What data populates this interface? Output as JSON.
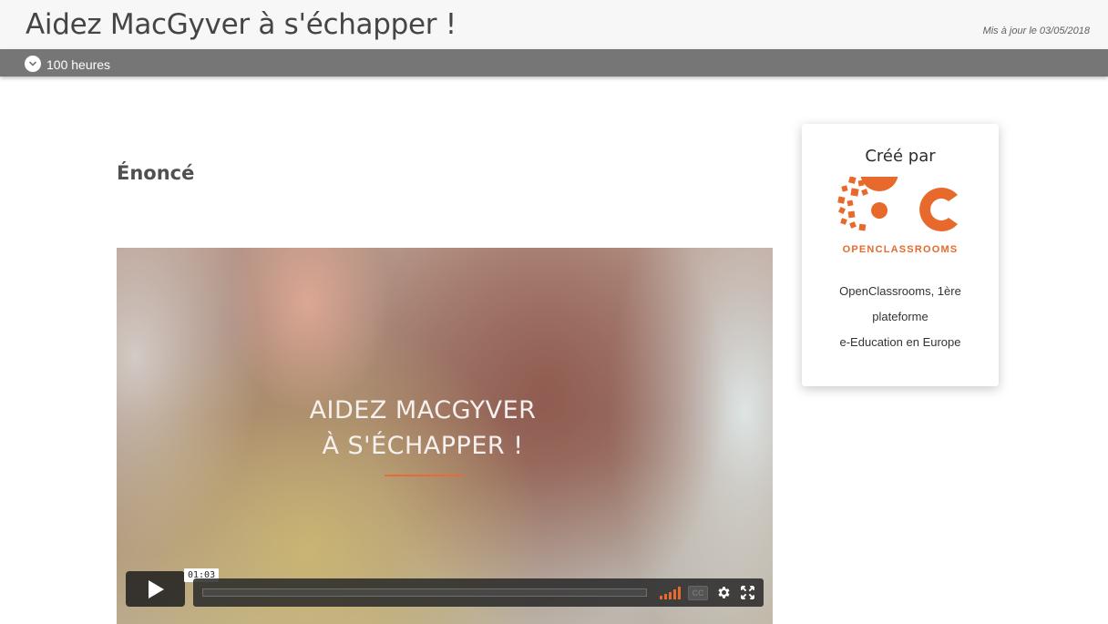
{
  "header": {
    "title": "Aidez MacGyver à s'échapper !",
    "updated": "Mis à jour le 03/05/2018"
  },
  "duration": {
    "icon": "chevron-down-icon",
    "label": "100 heures"
  },
  "main": {
    "section_title": "Énoncé"
  },
  "video": {
    "title_line1": "AIDEZ MACGYVER",
    "title_line2": "À S'ÉCHAPPER !",
    "duration_badge": "01:03",
    "progress": 0,
    "cc_label": "CC",
    "accent_color": "#e8692c"
  },
  "creator_card": {
    "title": "Créé par",
    "logo_text": "OPENCLASSROOMS",
    "desc_line1": "OpenClassrooms, 1ère",
    "desc_line2": "plateforme",
    "desc_line3": "e-Education en Europe",
    "brand_color": "#e8692c"
  }
}
